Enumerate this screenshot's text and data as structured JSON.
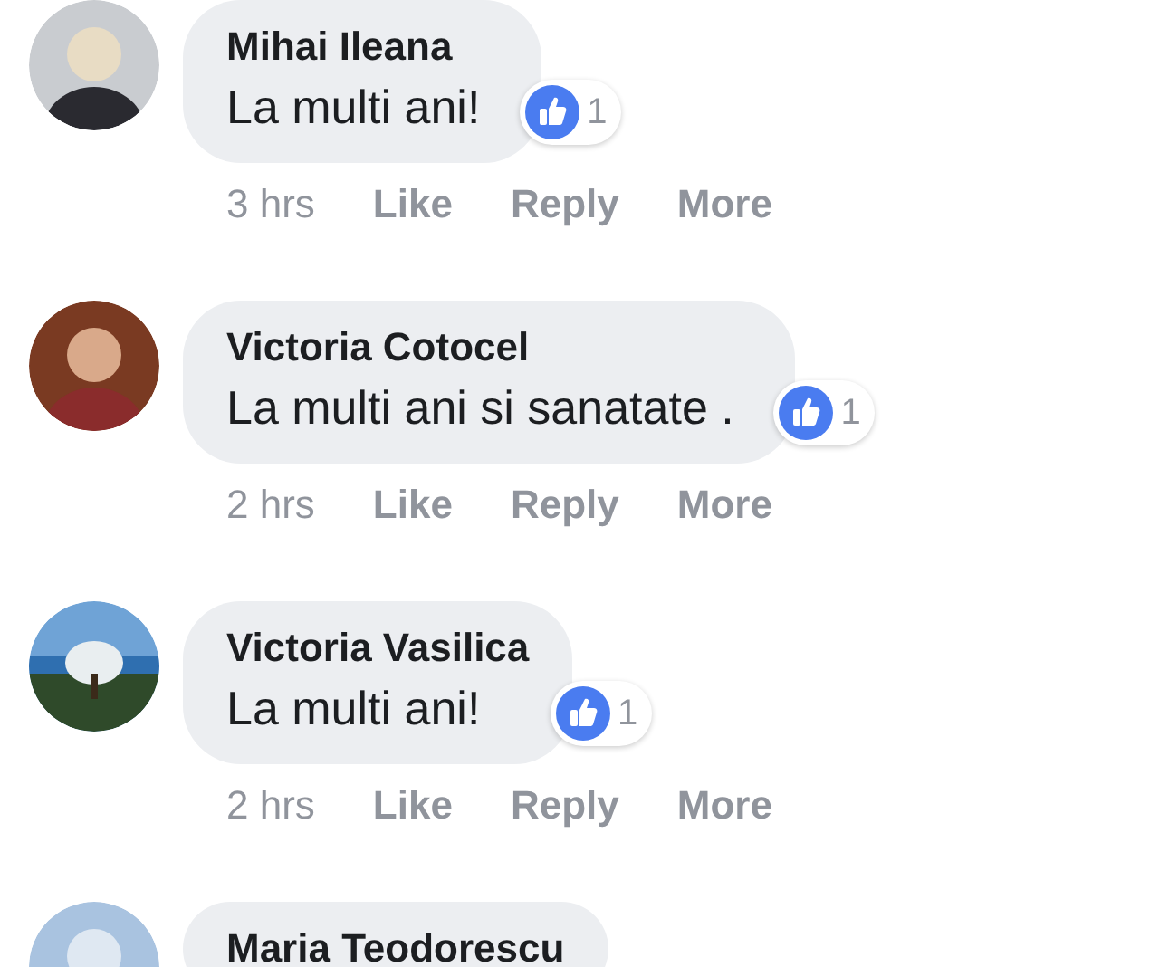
{
  "comments": [
    {
      "author": "Mihai Ileana",
      "message": "La multi ani!",
      "reaction_count": "1",
      "time": "3 hrs",
      "actions": [
        "Like",
        "Reply",
        "More"
      ],
      "avatar": {
        "kind": "picture"
      }
    },
    {
      "author": "Victoria Cotocel",
      "message": "La multi ani si sanatate .",
      "reaction_count": "1",
      "time": "2 hrs",
      "actions": [
        "Like",
        "Reply",
        "More"
      ],
      "avatar": {
        "kind": "picture"
      }
    },
    {
      "author": "Victoria Vasilica",
      "message": "La multi ani!",
      "reaction_count": "1",
      "time": "2 hrs",
      "actions": [
        "Like",
        "Reply",
        "More"
      ],
      "avatar": {
        "kind": "picture"
      }
    },
    {
      "author": "Maria Teodorescu",
      "avatar": {
        "kind": "picture"
      }
    }
  ]
}
